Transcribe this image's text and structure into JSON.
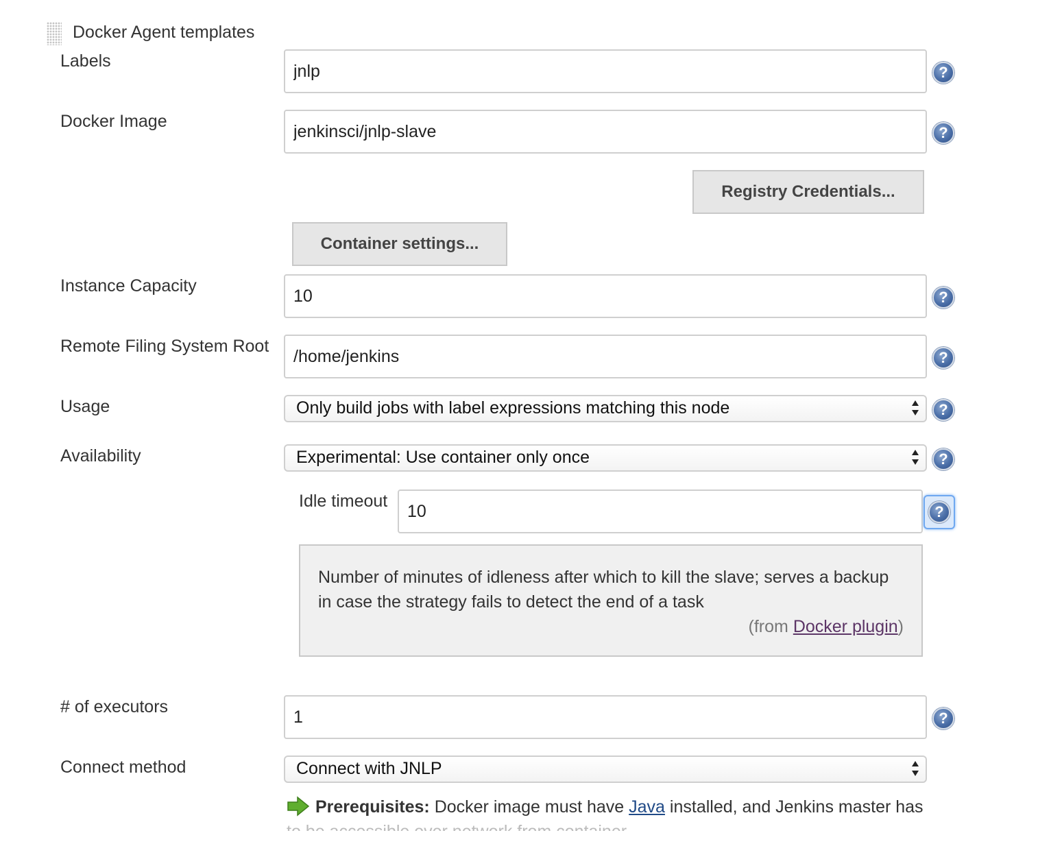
{
  "section": {
    "title": "Docker Agent templates"
  },
  "fields": {
    "labels": {
      "label": "Labels",
      "value": "jnlp"
    },
    "docker_image": {
      "label": "Docker Image",
      "value": "jenkinsci/jnlp-slave"
    },
    "instance_capacity": {
      "label": "Instance Capacity",
      "value": "10"
    },
    "remote_fs_root": {
      "label": "Remote Filing System Root",
      "value": "/home/jenkins"
    },
    "usage": {
      "label": "Usage",
      "selected": "Only build jobs with label expressions matching this node"
    },
    "availability": {
      "label": "Availability",
      "selected": "Experimental: Use container only once"
    },
    "idle_timeout": {
      "label": "Idle timeout",
      "value": "10"
    },
    "executors": {
      "label": "# of executors",
      "value": "1"
    },
    "connect_method": {
      "label": "Connect method",
      "selected": "Connect with JNLP"
    }
  },
  "buttons": {
    "registry_credentials": "Registry Credentials...",
    "container_settings": "Container settings..."
  },
  "help_panel": {
    "text": "Number of minutes of idleness after which to kill the slave; serves a backup in case the strategy fails to detect the end of a task",
    "from_prefix": "(from ",
    "from_link": "Docker plugin",
    "from_suffix": ")"
  },
  "prerequisites": {
    "bold": "Prerequisites:",
    "text_before_link": " Docker image must have ",
    "link": "Java",
    "text_after_link": " installed, and Jenkins master has",
    "line2": "to be accessible over network from container"
  },
  "icons": {
    "help": "help-question-icon",
    "arrow": "green-arrow-icon",
    "grip": "drag-handle-icon",
    "help_glyph": "?"
  },
  "colors": {
    "help_icon": "#4b6fa8",
    "button_bg": "#e6e6e6",
    "help_panel_bg": "#f0f0f0",
    "arrow": "#5fae2e",
    "link": "#204a87",
    "visited_link": "#5c3566"
  }
}
